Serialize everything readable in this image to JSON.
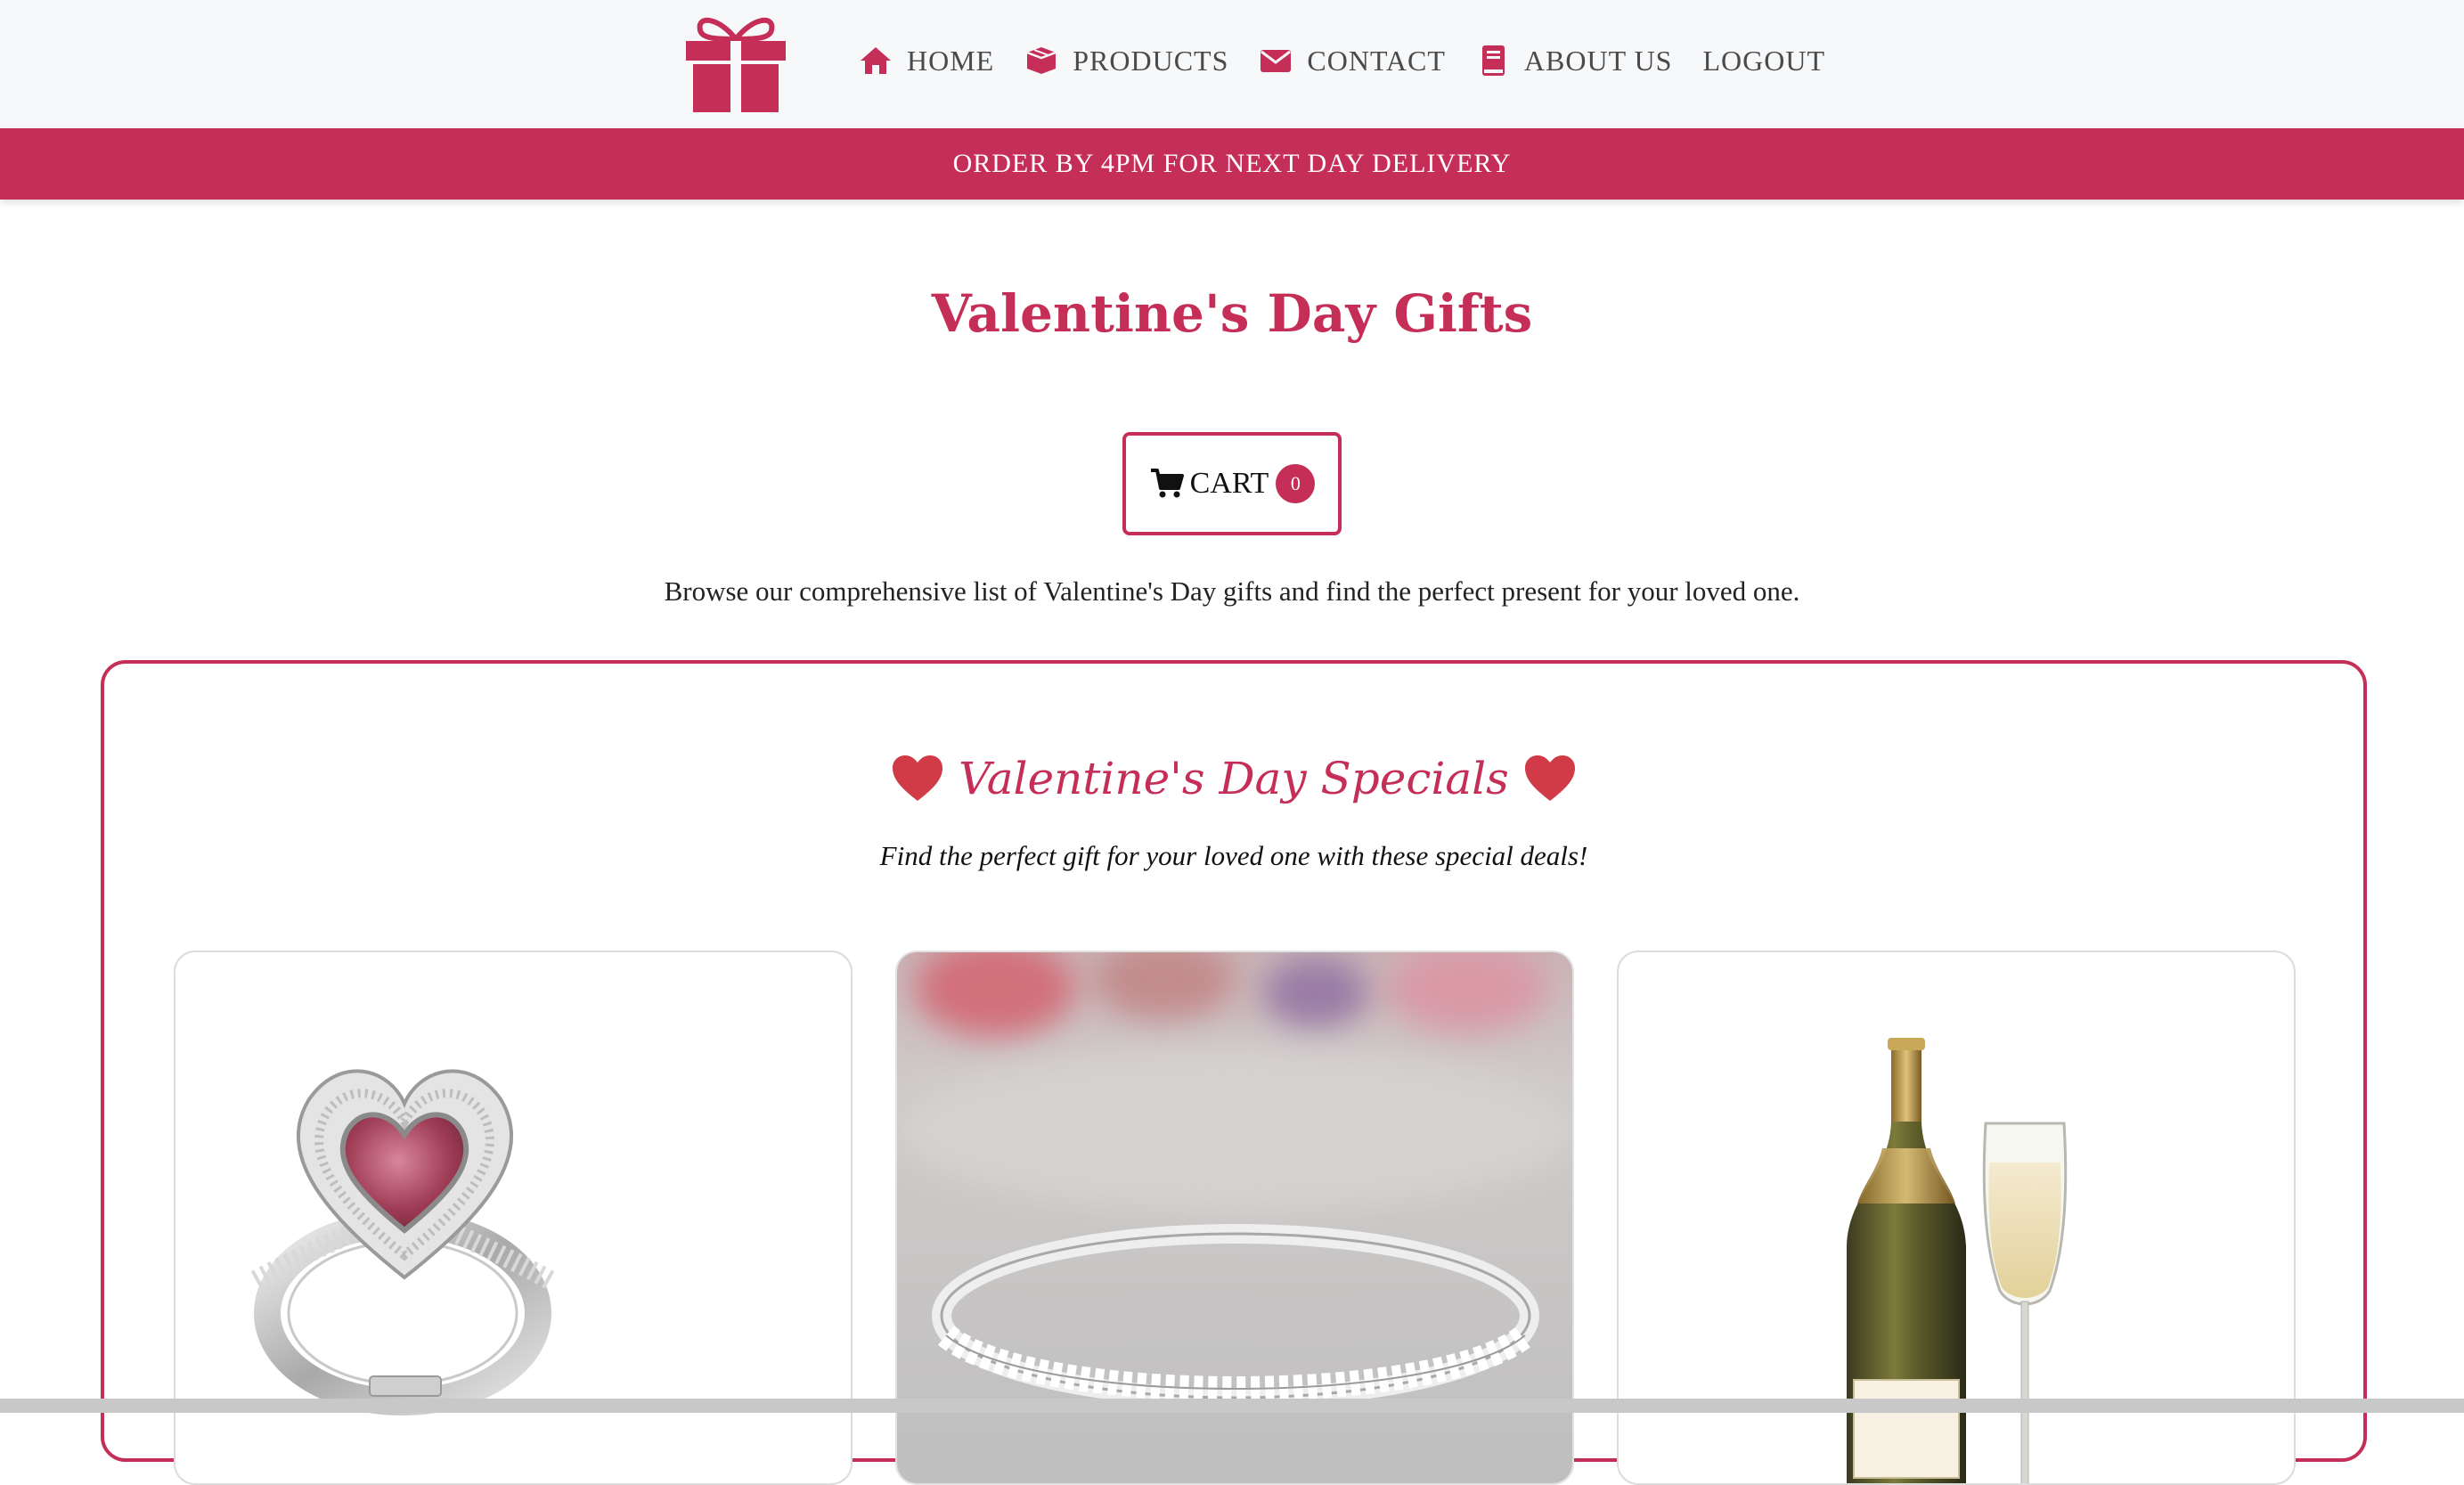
{
  "nav": {
    "items": [
      {
        "label": "HOME",
        "icon": "home-icon"
      },
      {
        "label": "PRODUCTS",
        "icon": "box-icon"
      },
      {
        "label": "CONTACT",
        "icon": "envelope-icon"
      },
      {
        "label": "ABOUT US",
        "icon": "book-icon"
      },
      {
        "label": "LOGOUT",
        "icon": ""
      }
    ]
  },
  "banner": {
    "text": "ORDER BY 4PM FOR NEXT DAY DELIVERY"
  },
  "main": {
    "title": "Valentine's Day Gifts",
    "cart": {
      "label": "CART",
      "count": "0"
    },
    "intro": "Browse our comprehensive list of Valentine's Day gifts and find the perfect present for your loved one."
  },
  "specials": {
    "title": "Valentine's Day Specials",
    "subtitle": "Find the perfect gift for your loved one with these special deals!"
  },
  "colors": {
    "brand": "#c52e57",
    "heart": "#d13b48",
    "nav_text": "#4a4a4a"
  }
}
